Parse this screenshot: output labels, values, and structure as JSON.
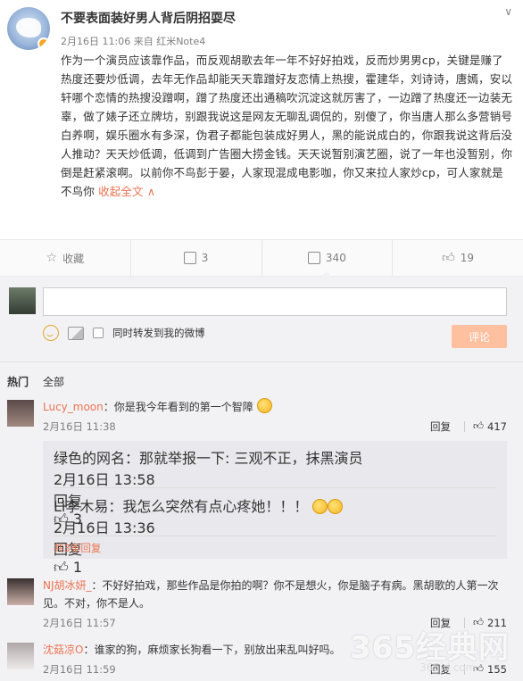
{
  "post": {
    "username": "不要表面装好男人背后阴招耍尽",
    "time": "2月16日 11:06",
    "source_prefix": "来自",
    "source": "红米Note4",
    "body": "作为一个演员应该靠作品，而反观胡歌去年一年不好好拍戏，反而炒男男cp，关键是赚了热度还要炒低调，去年无作品却能天天靠蹭好友恋情上热搜，霍建华，刘诗诗，唐嫣，安以轩哪个恋情的热搜没蹭啊，蹭了热度还出通稿吹沉淀这就厉害了，一边蹭了热度还一边装无辜，做了婊子还立牌坊，别跟我说这是网友无聊乱调侃的，别傻了，你当唐人那么多营销号白养啊，娱乐圈水有多深，伪君子都能包装成好男人，黑的能说成白的，你跟我说这背后没人推动？天天炒低调，低调到广告圈大捞金钱。天天说暂别演艺圈，说了一年也没暂别，你倒是赶紧滚啊。以前你不鸟彭于晏，人家现混成电影咖，你又来拉人家炒cp，可人家就是不鸟你",
    "collapse_label": "收起全文",
    "collapse_arrow": "∧"
  },
  "actions": {
    "favorite_label": "收藏",
    "forward_count": "3",
    "comment_count": "340",
    "like_count": "19"
  },
  "composer": {
    "forward_label": "同时转发到我的微博",
    "submit_label": "评论"
  },
  "tabs": {
    "hot": "热门",
    "all": "全部"
  },
  "comments": [
    {
      "name": "Lucy_moon",
      "text": "：你是我今年看到的第一个智障",
      "time": "2月16日 11:38",
      "reply": "回复",
      "likes": "417"
    },
    {
      "name": "NJ胡冰妍_",
      "text": "：不好好拍戏，那些作品是你拍的啊？你不是想火，你是脑子有病。黑胡歌的人第一次见。不对，你不是人。",
      "time": "2月16日 11:57",
      "reply": "回复",
      "likes": "211"
    },
    {
      "name": "沈菇凉O",
      "text": "：谁家的狗，麻烦家长狗看一下，别放出来乱叫好吗。",
      "time": "2月16日 11:59",
      "reply": "回复",
      "likes": "155"
    }
  ],
  "sub_replies": [
    {
      "name": "绿色的网名",
      "text": "：那就举报一下: 三观不正，抹黑演员",
      "time": "2月16日 13:58",
      "reply": "回复",
      "likes": "3"
    },
    {
      "name": "Li李木易",
      "text": "：我怎么突然有点心疼她！！！",
      "time": "2月16日 13:36",
      "reply": "回复",
      "likes": "1"
    }
  ],
  "sub_more": "共3条回复",
  "watermark": {
    "main": "365经典网",
    "sub": "365jd.com"
  },
  "colors": {
    "accent": "#eb7350",
    "submit_bg": "#ffc09f",
    "panel_bg": "#f2f2f5"
  }
}
